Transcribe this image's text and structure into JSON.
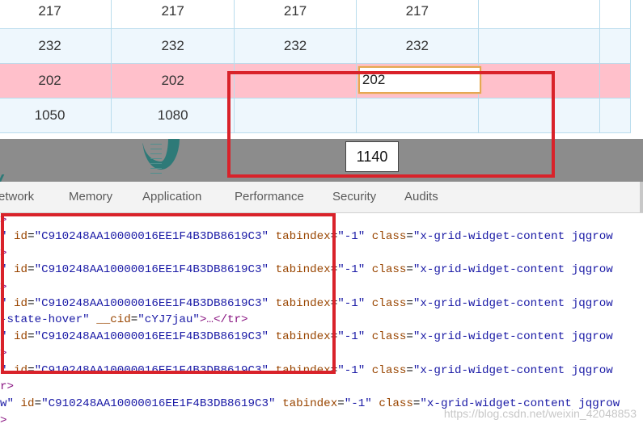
{
  "grid": {
    "rows": [
      {
        "type": "row-a",
        "cells": [
          "217",
          "217",
          "217",
          "217",
          ""
        ]
      },
      {
        "type": "row-b",
        "cells": [
          "232",
          "232",
          "232",
          "232",
          ""
        ]
      },
      {
        "type": "row-hover",
        "cells": [
          "202",
          "202",
          "",
          "",
          ""
        ],
        "edit_value": "202"
      },
      {
        "type": "row-b",
        "cells": [
          "1050",
          "1080",
          "",
          "",
          ""
        ]
      }
    ]
  },
  "popup": {
    "value": "1140"
  },
  "devtools": {
    "tabs": [
      "etwork",
      "Memory",
      "Application",
      "Performance",
      "Security",
      "Audits"
    ]
  },
  "elements": {
    "row_id_attr": "id",
    "row_id_value": "\"C910248AA10000016EE1F4B3DB8619C3\"",
    "tabindex_attr": "tabindex",
    "tabindex_value": "\"-1\"",
    "class_attr": "class",
    "class_value": "\"x-grid-widget-content jqgrow",
    "hover_fragment": "-state-hover\"",
    "cid_attr": "__cid",
    "cid_value": "\"cYJ7jau\"",
    "tail": ">…</tr>",
    "gt": ">",
    "quote_prefix": "\"",
    "r_gt": "r>",
    "w_quote": "w\""
  },
  "watermark": "https://blog.csdn.net/weixin_42048853",
  "colors": {
    "highlight_red": "#d9222a",
    "row_hover": "#ffc0cb",
    "edit_border": "#e5a852"
  }
}
